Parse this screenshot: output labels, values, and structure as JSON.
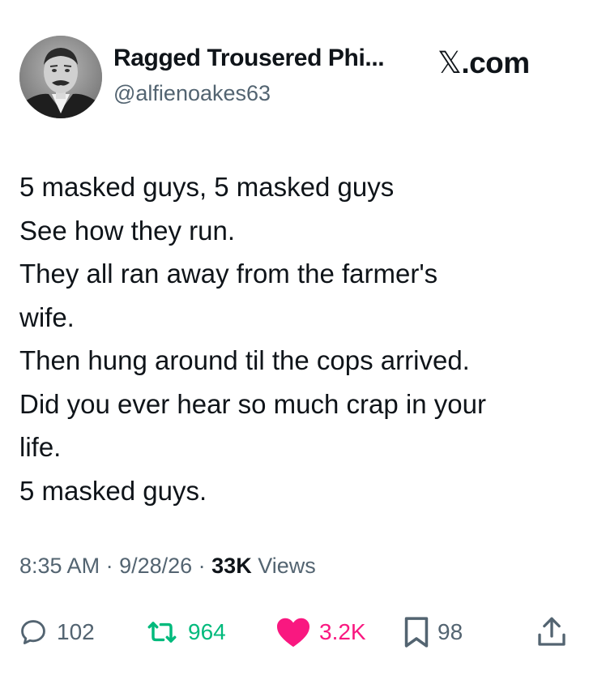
{
  "author": {
    "display_name": "Ragged Trousered Phi...",
    "handle": "@alfienoakes63"
  },
  "brand": {
    "glyph": "𝕏",
    "suffix": ".com"
  },
  "tweet": {
    "lines": [
      "5 masked guys, 5 masked guys",
      "See how they run.",
      "They all ran away from the farmer's",
      "wife.",
      "Then hung around til the cops arrived.",
      "Did you ever hear so much crap in your",
      "life.",
      "5 masked guys."
    ]
  },
  "meta": {
    "time": "8:35 AM",
    "sep1": " · ",
    "date": "9/28/26",
    "sep2": " · ",
    "views_count": "33K",
    "views_label": " Views"
  },
  "actions": {
    "reply_count": "102",
    "repost_count": "964",
    "like_count": "3.2K",
    "bookmark_count": "98"
  },
  "colors": {
    "text": "#0f1419",
    "secondary": "#536471",
    "repost": "#00ba7c",
    "like": "#f91880"
  },
  "icons": [
    "reply-icon",
    "repost-icon",
    "like-icon",
    "bookmark-icon",
    "share-icon"
  ]
}
